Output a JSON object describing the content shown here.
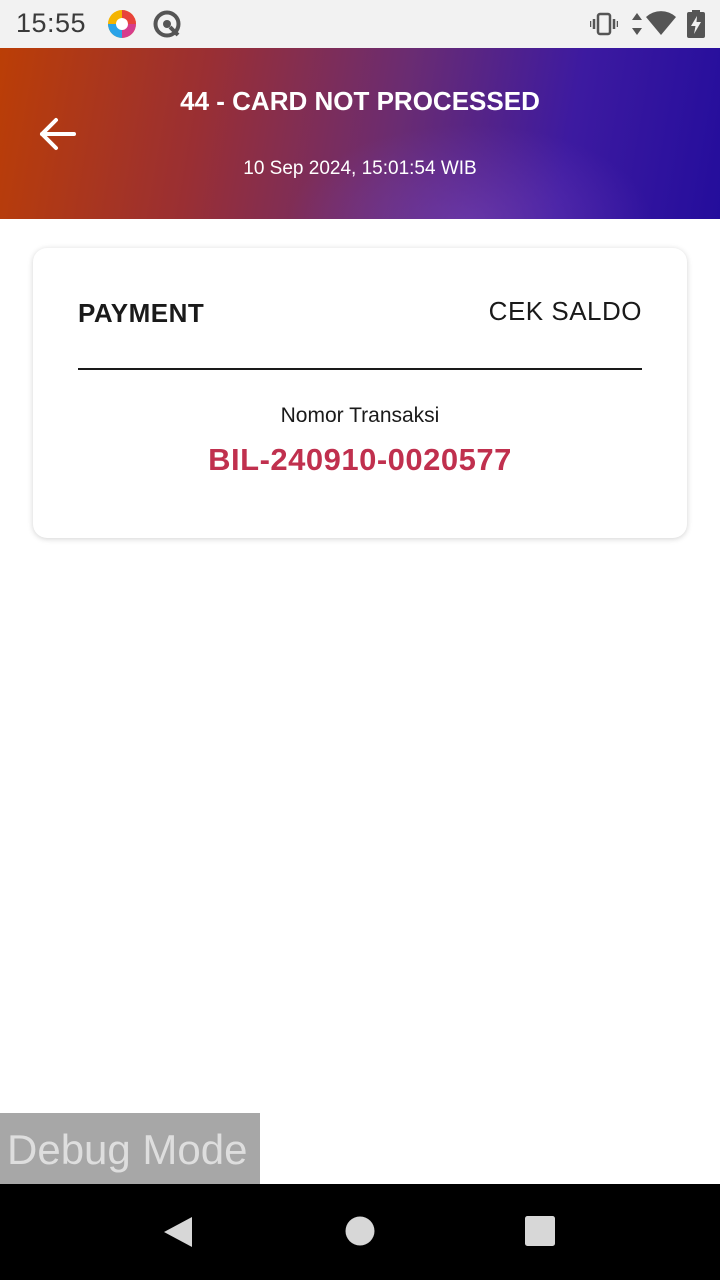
{
  "status_bar": {
    "time": "15:55",
    "icons": [
      "app-notification-icon",
      "quick-settings-icon",
      "vibrate-icon",
      "data-transfer-icon",
      "wifi-icon",
      "battery-charging-icon"
    ]
  },
  "header": {
    "back_icon": "arrow-left-icon",
    "title": "44 - CARD NOT PROCESSED",
    "subtitle": "10 Sep 2024, 15:01:54 WIB",
    "gradient_colors": [
      "#bb3e06",
      "#6a2c72",
      "#240d9c"
    ]
  },
  "card": {
    "left_label": "PAYMENT",
    "right_label": "CEK SALDO",
    "transaction_label": "Nomor Transaksi",
    "transaction_number": "BIL-240910-0020577",
    "transaction_color": "#c0304e"
  },
  "debug": {
    "label": "Debug Mode"
  },
  "nav_bar": {
    "buttons": [
      "back-triangle-icon",
      "home-circle-icon",
      "recents-square-icon"
    ]
  }
}
